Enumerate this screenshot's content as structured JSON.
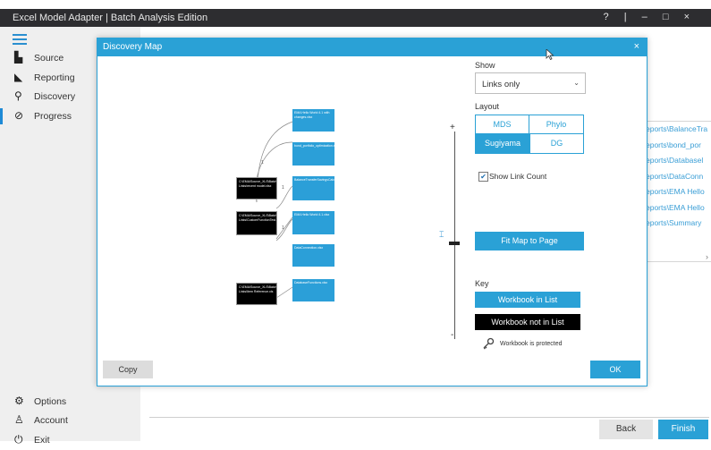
{
  "app": {
    "title": "Excel Model Adapter | Batch Analysis Edition",
    "controls": [
      "?",
      "|",
      "–",
      "□",
      "×"
    ]
  },
  "sidebar": {
    "items": [
      {
        "label": "Source",
        "icon": "source-icon"
      },
      {
        "label": "Reporting",
        "icon": "reporting-icon"
      },
      {
        "label": "Discovery",
        "icon": "search-icon"
      },
      {
        "label": "Progress",
        "icon": "progress-icon"
      }
    ],
    "bottom": [
      {
        "label": "Options",
        "icon": "gear-icon"
      },
      {
        "label": "Account",
        "icon": "user-icon"
      },
      {
        "label": "Exit",
        "icon": "power-icon"
      }
    ]
  },
  "background_list": [
    "eports\\BalanceTra",
    "eports\\bond_por",
    "eports\\Databasel",
    "eports\\DataConn",
    "eports\\EMA Hello",
    "eports\\EMA Hello",
    "eports\\Summary"
  ],
  "footer": {
    "back_label": "Back",
    "finish_label": "Finish"
  },
  "dialog": {
    "title": "Discovery Map",
    "close": "×",
    "show_label": "Show",
    "show_value": "Links only",
    "layout_label": "Layout",
    "layout_options": [
      "MDS",
      "Phylo",
      "Sugiyama",
      "DG"
    ],
    "layout_selected": "Sugiyama",
    "show_link_count_label": "Show Link Count",
    "show_link_count_checked": true,
    "fit_button": "Fit Map to Page",
    "key_label": "Key",
    "key_in_list": "Workbook in List",
    "key_not_in_list": "Workbook not in List",
    "key_protected": "Workbook is protected",
    "copy_button": "Copy",
    "ok_button": "OK",
    "zoom_plus": "+",
    "zoom_minus": "-",
    "edge_labels": [
      "1",
      "1",
      "1"
    ],
    "map_nodes": [
      {
        "text": "EMA Hello World 4.1 with changes.xlsx",
        "type": "in-list"
      },
      {
        "text": "bond_portfolio_optimization.xls",
        "type": "in-list"
      },
      {
        "text": "BalanceTransferSavingsCalculator.xlsx",
        "type": "in-list"
      },
      {
        "text": "EMA Hello World 4.1.xlsx",
        "type": "in-list"
      },
      {
        "text": "DataConnection.xlsx",
        "type": "in-list"
      },
      {
        "text": "DatabaseFunctions.xlsx",
        "type": "in-list"
      },
      {
        "text": "C:\\EMA\\Source_XLS\\Batch Links\\recent model.xlsx",
        "type": "not-in-list"
      },
      {
        "text": "C:\\EMA\\Source_XLS\\Batch Links\\CustomFunctionTest.xlsx",
        "type": "not-in-list"
      },
      {
        "text": "C:\\EMA\\Source_XLS\\Batch Links\\Item Reference.xls",
        "type": "not-in-list"
      }
    ]
  },
  "colors": {
    "accent": "#2aa1d6",
    "titlebar": "#2d2d30",
    "sidebar": "#efefef"
  }
}
